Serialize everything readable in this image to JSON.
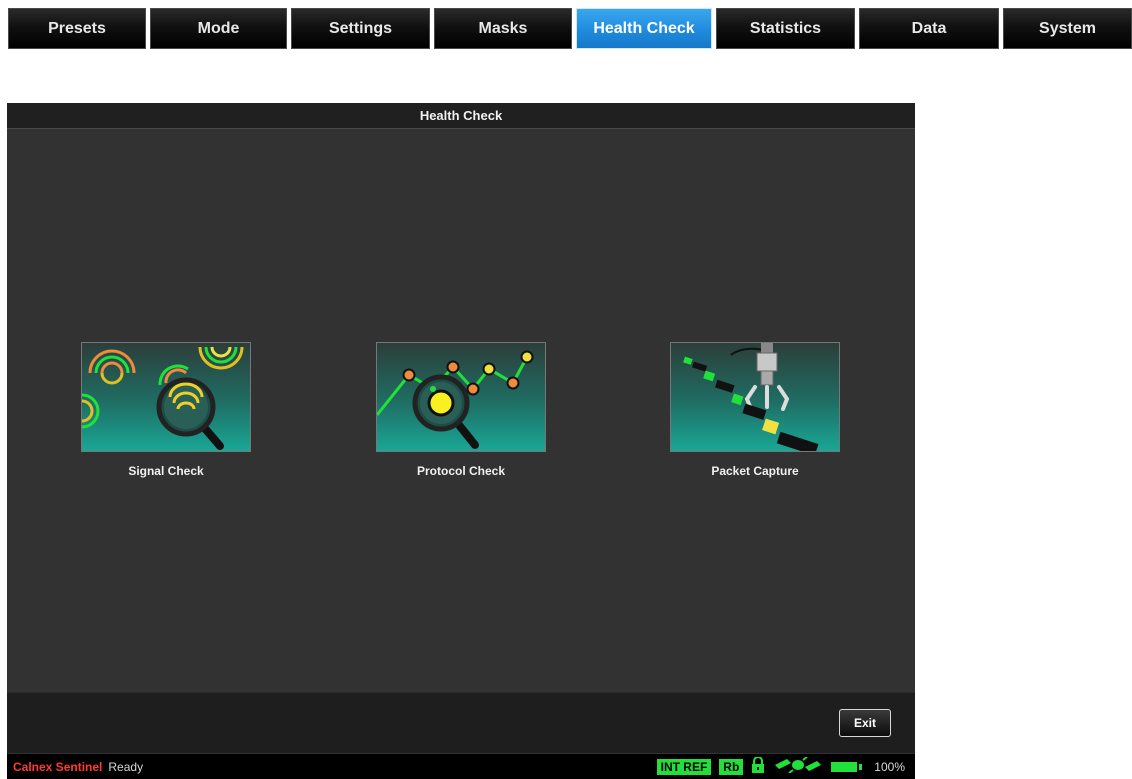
{
  "tabs": [
    {
      "label": "Presets"
    },
    {
      "label": "Mode"
    },
    {
      "label": "Settings"
    },
    {
      "label": "Masks"
    },
    {
      "label": "Health Check"
    },
    {
      "label": "Statistics"
    },
    {
      "label": "Data"
    },
    {
      "label": "System"
    }
  ],
  "active_tab": "Health Check",
  "window": {
    "title": "Health Check"
  },
  "cards": [
    {
      "label": "Signal Check",
      "icon": "signal-check-icon"
    },
    {
      "label": "Protocol Check",
      "icon": "protocol-check-icon"
    },
    {
      "label": "Packet Capture",
      "icon": "packet-capture-icon"
    }
  ],
  "footer": {
    "exit_label": "Exit"
  },
  "status": {
    "brand": "Calnex Sentinel",
    "state": "Ready",
    "int_ref": "INT REF",
    "rb": "Rb",
    "battery": "100%"
  },
  "colors": {
    "active_tab": "#1e88dc",
    "status_green": "#22e03a",
    "brand_red": "#ff3b30",
    "panel_bg": "#323232"
  }
}
